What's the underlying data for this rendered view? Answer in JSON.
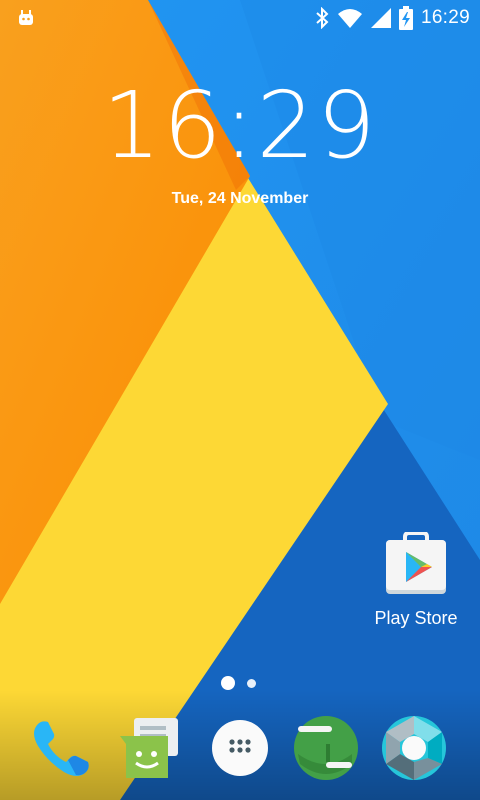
{
  "status_bar": {
    "time": "16:29",
    "icons": [
      "android-icon",
      "bluetooth-icon",
      "wifi-icon",
      "cell-signal-icon",
      "battery-charging-icon"
    ]
  },
  "lockscreen": {
    "clock": "16:29",
    "date": "Tue, 24 November"
  },
  "desktop": {
    "apps": [
      {
        "label": "Play Store",
        "icon": "play-store-icon"
      }
    ],
    "pages": 2,
    "current_page": 1
  },
  "dock": {
    "items": [
      {
        "icon": "phone-icon"
      },
      {
        "icon": "messaging-icon"
      },
      {
        "icon": "app-drawer-icon"
      },
      {
        "icon": "hangouts-icon"
      },
      {
        "icon": "camera-icon"
      }
    ]
  },
  "colors": {
    "orange": "#FF9800",
    "yellow": "#FFD740",
    "blue_light": "#2196F3",
    "blue_dark": "#1565C0"
  }
}
